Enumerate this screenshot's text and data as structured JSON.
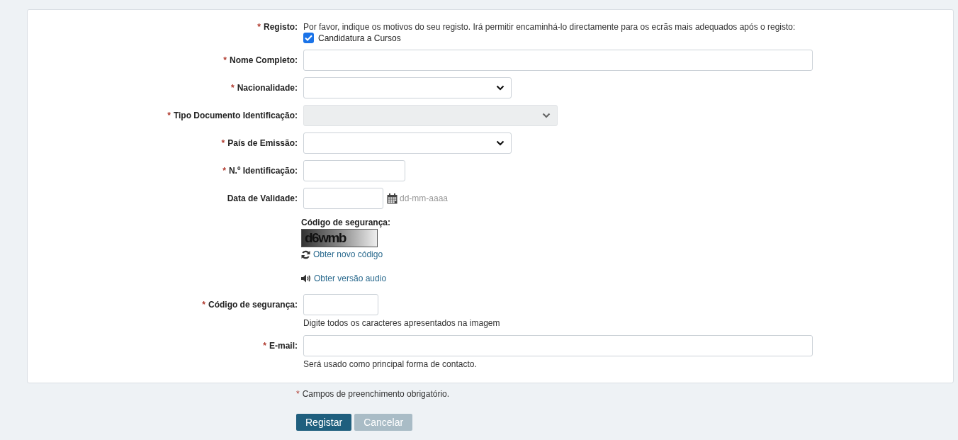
{
  "form": {
    "fields": [
      {
        "kind": "checkboxes",
        "required_mark": "*",
        "label": "Registo:",
        "intro": "Por favor, indique os motivos do seu registo. Irá permitir encaminhá-lo directamente para os ecrãs mais adequados após o registo:",
        "options": [
          {
            "label": "Candidatura a Cursos",
            "checked": true
          }
        ]
      },
      {
        "kind": "text",
        "required_mark": "*",
        "label": "Nome Completo:"
      },
      {
        "kind": "select",
        "required_mark": "*",
        "label": "Nacionalidade:",
        "disabled": false
      },
      {
        "kind": "select",
        "required_mark": "*",
        "label": "Tipo Documento Identificação:",
        "disabled": true
      },
      {
        "kind": "select",
        "required_mark": "*",
        "label": "País de Emissão:",
        "disabled": false
      },
      {
        "kind": "text",
        "required_mark": "*",
        "label": "N.º Identificação:"
      },
      {
        "kind": "date",
        "label": "Data de Validade:",
        "hint": "dd-mm-aaaa"
      },
      {
        "kind": "captcha",
        "title": "Código de segurança:",
        "code": "d6wmb",
        "refresh_link": "Obter novo código",
        "audio_link": "Obter versão audio"
      },
      {
        "kind": "text",
        "required_mark": "*",
        "label": "Código de segurança:",
        "help": "Digite todos os caracteres apresentados na imagem"
      },
      {
        "kind": "text",
        "required_mark": "*",
        "label": "E-mail:",
        "help": "Será usado como principal forma de contacto."
      }
    ]
  },
  "footer": {
    "required_mark": "*",
    "note": "Campos de preenchimento obrigatório."
  },
  "buttons": [
    {
      "label": "Registar",
      "disabled": false
    },
    {
      "label": "Cancelar",
      "disabled": true
    }
  ]
}
